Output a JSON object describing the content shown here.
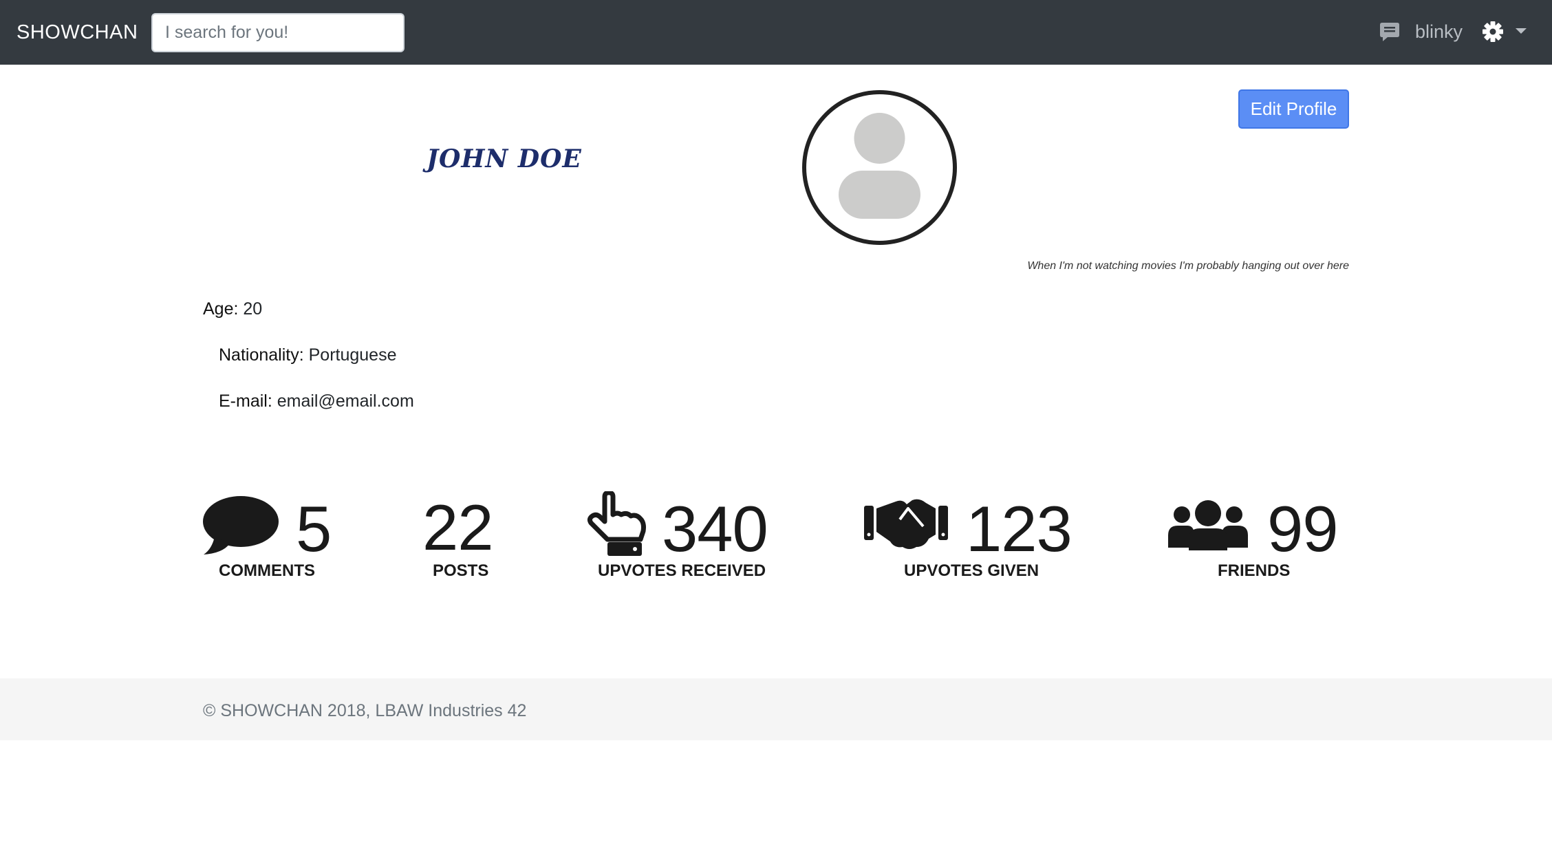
{
  "navbar": {
    "brand": "SHOWCHAN",
    "search_placeholder": "I search for you!",
    "username": "blinky"
  },
  "profile": {
    "name": "JOHN DOE",
    "edit_button": "Edit Profile",
    "tagline": "When I'm not watching movies I'm probably hanging out over here",
    "fields": {
      "age_label": "Age:",
      "age_value": "20",
      "nationality_label": "Nationality:",
      "nationality_value": "Portuguese",
      "email_label": "E-mail:",
      "email_value": "email@email.com"
    }
  },
  "stats": {
    "comments": {
      "value": "5",
      "label": "COMMENTS",
      "icon": "speech-bubble-icon"
    },
    "posts": {
      "value": "22",
      "label": "POSTS"
    },
    "upvotes_received": {
      "value": "340",
      "label": "UPVOTES RECEIVED",
      "icon": "pointing-hand-icon"
    },
    "upvotes_given": {
      "value": "123",
      "label": "UPVOTES GIVEN",
      "icon": "handshake-icon"
    },
    "friends": {
      "value": "99",
      "label": "FRIENDS",
      "icon": "users-icon"
    }
  },
  "footer": {
    "text": "© SHOWCHAN 2018, LBAW Industries 42"
  },
  "colors": {
    "navbar_bg": "#343a40",
    "button_bg": "#5b8ef5",
    "name_color": "#1d2d6b",
    "footer_bg": "#f5f5f5"
  }
}
